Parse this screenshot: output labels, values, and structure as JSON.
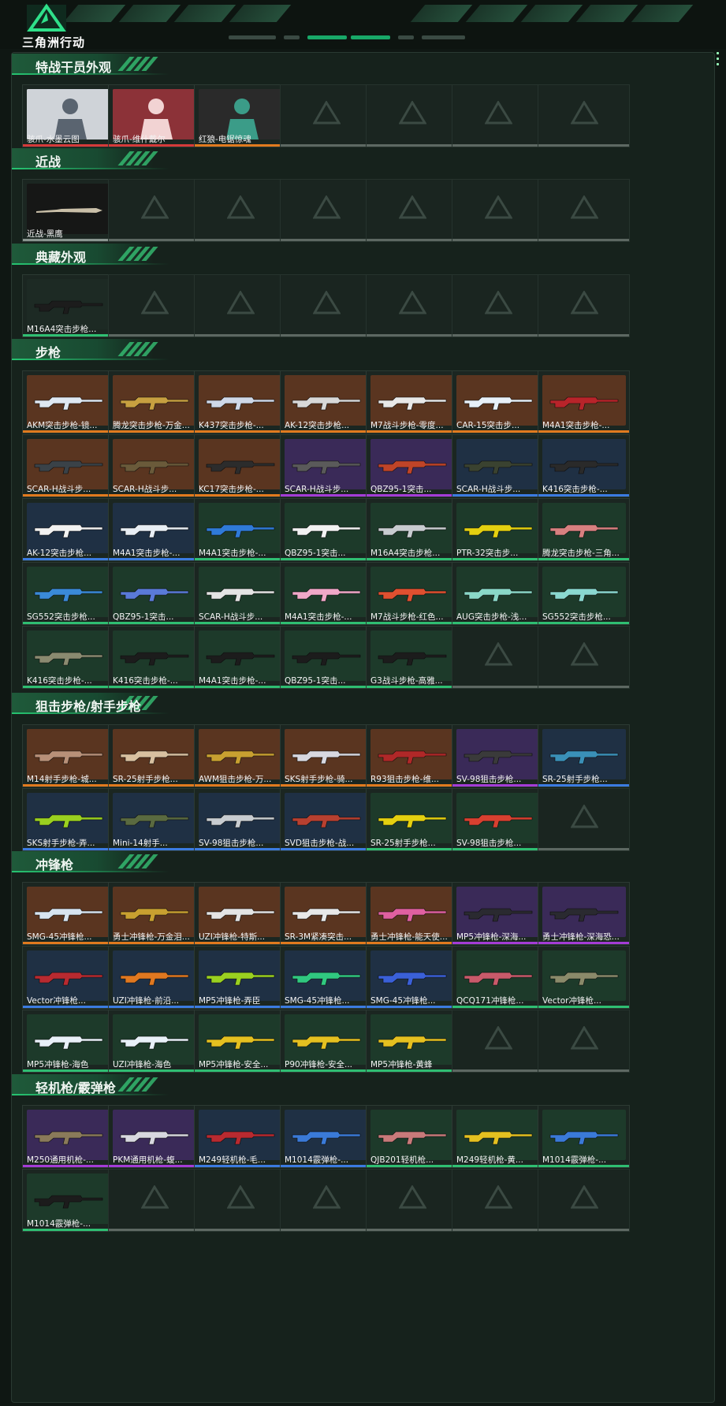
{
  "brand": {
    "title": "三角洲行动"
  },
  "colors": {
    "gold": "#e07a1e",
    "purple": "#a43cd6",
    "blue": "#3b7be0",
    "green": "#2fbe72",
    "red": "#d53a3a",
    "grey": "#8a9690"
  },
  "sections": [
    {
      "title": "特战干员外观",
      "items": [
        {
          "name": "骇爪-水墨云图",
          "rarity": "red",
          "kind": "portrait",
          "bg": "#cfd3d8",
          "fg": "#5a6470"
        },
        {
          "name": "骇爪-维什戴尔",
          "rarity": "red",
          "kind": "portrait",
          "bg": "#8c3238",
          "fg": "#f2d3d3"
        },
        {
          "name": "红狼-电锯惊魂",
          "rarity": "gold",
          "kind": "portrait",
          "bg": "#2a2a2a",
          "fg": "#3b9c88"
        },
        {
          "empty": true
        },
        {
          "empty": true
        },
        {
          "empty": true
        },
        {
          "empty": true
        }
      ]
    },
    {
      "title": "近战",
      "items": [
        {
          "name": "近战-黑鹰",
          "rarity": "grey",
          "kind": "knife",
          "bg": "#161716",
          "fg": "#c9bfa8"
        },
        {
          "empty": true
        },
        {
          "empty": true
        },
        {
          "empty": true
        },
        {
          "empty": true
        },
        {
          "empty": true
        },
        {
          "empty": true
        }
      ]
    },
    {
      "title": "典藏外观",
      "items": [
        {
          "name": "M16A4突击步枪...",
          "rarity": "green",
          "kind": "gun",
          "bg": "#1d2a24",
          "fg": "#1c1c1c"
        },
        {
          "empty": true
        },
        {
          "empty": true
        },
        {
          "empty": true
        },
        {
          "empty": true
        },
        {
          "empty": true
        },
        {
          "empty": true
        }
      ]
    },
    {
      "title": "步枪",
      "items": [
        {
          "name": "AKM突击步枪-镜...",
          "rarity": "gold",
          "kind": "gun",
          "bg": "#5a3520",
          "fg": "#dfe8f2"
        },
        {
          "name": "腾龙突击步枪-万金...",
          "rarity": "gold",
          "kind": "gun",
          "bg": "#5a3520",
          "fg": "#c7a040"
        },
        {
          "name": "K437突击步枪-...",
          "rarity": "gold",
          "kind": "gun",
          "bg": "#5a3520",
          "fg": "#cfd8e8"
        },
        {
          "name": "AK-12突击步枪...",
          "rarity": "gold",
          "kind": "gun",
          "bg": "#5a3520",
          "fg": "#d8d8d8"
        },
        {
          "name": "M7战斗步枪-零度...",
          "rarity": "gold",
          "kind": "gun",
          "bg": "#5a3520",
          "fg": "#e8e8e8"
        },
        {
          "name": "CAR-15突击步...",
          "rarity": "gold",
          "kind": "gun",
          "bg": "#5a3520",
          "fg": "#e8f0f8"
        },
        {
          "name": "M4A1突击步枪-...",
          "rarity": "gold",
          "kind": "gun",
          "bg": "#5a3520",
          "fg": "#b8242a"
        },
        {
          "name": "SCAR-H战斗步...",
          "rarity": "gold",
          "kind": "gun",
          "bg": "#5a3520",
          "fg": "#3a4248"
        },
        {
          "name": "SCAR-H战斗步...",
          "rarity": "gold",
          "kind": "gun",
          "bg": "#5a3520",
          "fg": "#6a5a3a"
        },
        {
          "name": "KC17突击步枪-...",
          "rarity": "gold",
          "kind": "gun",
          "bg": "#5a3520",
          "fg": "#2c2c2c"
        },
        {
          "name": "SCAR-H战斗步...",
          "rarity": "purple",
          "kind": "gun",
          "bg": "#3a2a58",
          "fg": "#5a5a5a"
        },
        {
          "name": "QBZ95-1突击...",
          "rarity": "purple",
          "kind": "gun",
          "bg": "#3a2a58",
          "fg": "#c04428"
        },
        {
          "name": "SCAR-H战斗步...",
          "rarity": "blue",
          "kind": "gun",
          "bg": "#1f3044",
          "fg": "#3a4230"
        },
        {
          "name": "K416突击步枪-...",
          "rarity": "blue",
          "kind": "gun",
          "bg": "#1f3044",
          "fg": "#2a2a2a"
        },
        {
          "name": "AK-12突击步枪...",
          "rarity": "blue",
          "kind": "gun",
          "bg": "#1f3044",
          "fg": "#f2f2f2"
        },
        {
          "name": "M4A1突击步枪-...",
          "rarity": "blue",
          "kind": "gun",
          "bg": "#1f3044",
          "fg": "#e8eef4"
        },
        {
          "name": "M4A1突击步枪-...",
          "rarity": "green",
          "kind": "gun",
          "bg": "#1d3a2a",
          "fg": "#2f7ad8"
        },
        {
          "name": "QBZ95-1突击...",
          "rarity": "green",
          "kind": "gun",
          "bg": "#1d3a2a",
          "fg": "#f2f2f2"
        },
        {
          "name": "M16A4突击步枪...",
          "rarity": "green",
          "kind": "gun",
          "bg": "#1d3a2a",
          "fg": "#c8ccd0"
        },
        {
          "name": "PTR-32突击步...",
          "rarity": "green",
          "kind": "gun",
          "bg": "#1d3a2a",
          "fg": "#e4d010"
        },
        {
          "name": "腾龙突击步枪-三角...",
          "rarity": "green",
          "kind": "gun",
          "bg": "#1d3a2a",
          "fg": "#d88080"
        },
        {
          "name": "SG552突击步枪...",
          "rarity": "green",
          "kind": "gun",
          "bg": "#1d3a2a",
          "fg": "#3a8ad8"
        },
        {
          "name": "QBZ95-1突击...",
          "rarity": "green",
          "kind": "gun",
          "bg": "#1d3a2a",
          "fg": "#5a7ad8"
        },
        {
          "name": "SCAR-H战斗步...",
          "rarity": "green",
          "kind": "gun",
          "bg": "#1d3a2a",
          "fg": "#e4e4e4"
        },
        {
          "name": "M4A1突击步枪-...",
          "rarity": "green",
          "kind": "gun",
          "bg": "#1d3a2a",
          "fg": "#f0a8c8"
        },
        {
          "name": "M7战斗步枪-红色...",
          "rarity": "green",
          "kind": "gun",
          "bg": "#1d3a2a",
          "fg": "#e05030"
        },
        {
          "name": "AUG突击步枪-浅...",
          "rarity": "green",
          "kind": "gun",
          "bg": "#1d3a2a",
          "fg": "#8ad8c8"
        },
        {
          "name": "SG552突击步枪...",
          "rarity": "green",
          "kind": "gun",
          "bg": "#1d3a2a",
          "fg": "#8ad8d0"
        },
        {
          "name": "K416突击步枪-...",
          "rarity": "green",
          "kind": "gun",
          "bg": "#1d3a2a",
          "fg": "#8a8a70"
        },
        {
          "name": "K416突击步枪-...",
          "rarity": "green",
          "kind": "gun",
          "bg": "#1d3a2a",
          "fg": "#1c1c1c"
        },
        {
          "name": "M4A1突击步枪-...",
          "rarity": "green",
          "kind": "gun",
          "bg": "#1d3a2a",
          "fg": "#1c1c1c"
        },
        {
          "name": "QBZ95-1突击...",
          "rarity": "green",
          "kind": "gun",
          "bg": "#1d3a2a",
          "fg": "#1c1c1c"
        },
        {
          "name": "G3战斗步枪-高雅...",
          "rarity": "green",
          "kind": "gun",
          "bg": "#1d3a2a",
          "fg": "#1c1c1c"
        },
        {
          "empty": true
        },
        {
          "empty": true
        }
      ]
    },
    {
      "title": "狙击步枪/射手步枪",
      "items": [
        {
          "name": "M14射手步枪-城...",
          "rarity": "gold",
          "kind": "gun",
          "bg": "#5a3520",
          "fg": "#b89078"
        },
        {
          "name": "SR-25射手步枪...",
          "rarity": "gold",
          "kind": "gun",
          "bg": "#5a3520",
          "fg": "#d8c0a0"
        },
        {
          "name": "AWM狙击步枪-万...",
          "rarity": "gold",
          "kind": "gun",
          "bg": "#5a3520",
          "fg": "#c8a030"
        },
        {
          "name": "SKS射手步枪-骑...",
          "rarity": "gold",
          "kind": "gun",
          "bg": "#5a3520",
          "fg": "#d8d8e0"
        },
        {
          "name": "R93狙击步枪-维...",
          "rarity": "gold",
          "kind": "gun",
          "bg": "#5a3520",
          "fg": "#b02828"
        },
        {
          "name": "SV-98狙击步枪...",
          "rarity": "purple",
          "kind": "gun",
          "bg": "#3a2a58",
          "fg": "#3a3a3a"
        },
        {
          "name": "SR-25射手步枪...",
          "rarity": "blue",
          "kind": "gun",
          "bg": "#1f3044",
          "fg": "#3a90b8"
        },
        {
          "name": "SKS射手步枪-弄...",
          "rarity": "blue",
          "kind": "gun",
          "bg": "#1f3044",
          "fg": "#9ad020"
        },
        {
          "name": "Mini-14射手...",
          "rarity": "blue",
          "kind": "gun",
          "bg": "#1f3044",
          "fg": "#5a6a40"
        },
        {
          "name": "SV-98狙击步枪...",
          "rarity": "blue",
          "kind": "gun",
          "bg": "#1f3044",
          "fg": "#c8ccd0"
        },
        {
          "name": "SVD狙击步枪-战...",
          "rarity": "blue",
          "kind": "gun",
          "bg": "#1f3044",
          "fg": "#b84030"
        },
        {
          "name": "SR-25射手步枪...",
          "rarity": "green",
          "kind": "gun",
          "bg": "#1d3a2a",
          "fg": "#e4d010"
        },
        {
          "name": "SV-98狙击步枪...",
          "rarity": "green",
          "kind": "gun",
          "bg": "#1d3a2a",
          "fg": "#d84030"
        },
        {
          "empty": true
        }
      ]
    },
    {
      "title": "冲锋枪",
      "items": [
        {
          "name": "SMG-45冲锋枪...",
          "rarity": "gold",
          "kind": "gun",
          "bg": "#5a3520",
          "fg": "#d8e4f0"
        },
        {
          "name": "勇士冲锋枪-万金泪...",
          "rarity": "gold",
          "kind": "gun",
          "bg": "#5a3520",
          "fg": "#c8a030"
        },
        {
          "name": "UZI冲锋枪-特斯...",
          "rarity": "gold",
          "kind": "gun",
          "bg": "#5a3520",
          "fg": "#e4e4e4"
        },
        {
          "name": "SR-3M紧凑突击...",
          "rarity": "gold",
          "kind": "gun",
          "bg": "#5a3520",
          "fg": "#e8e8e8"
        },
        {
          "name": "勇士冲锋枪-能天使...",
          "rarity": "gold",
          "kind": "gun",
          "bg": "#5a3520",
          "fg": "#e060a0"
        },
        {
          "name": "MP5冲锋枪-深海...",
          "rarity": "purple",
          "kind": "gun",
          "bg": "#3a2a58",
          "fg": "#2a2a30"
        },
        {
          "name": "勇士冲锋枪-深海恐...",
          "rarity": "purple",
          "kind": "gun",
          "bg": "#3a2a58",
          "fg": "#2a2a30"
        },
        {
          "name": "Vector冲锋枪...",
          "rarity": "blue",
          "kind": "gun",
          "bg": "#1f3044",
          "fg": "#b82a30"
        },
        {
          "name": "UZI冲锋枪-前沿...",
          "rarity": "blue",
          "kind": "gun",
          "bg": "#1f3044",
          "fg": "#e07820"
        },
        {
          "name": "MP5冲锋枪-弄臣",
          "rarity": "blue",
          "kind": "gun",
          "bg": "#1f3044",
          "fg": "#9ad020"
        },
        {
          "name": "SMG-45冲锋枪...",
          "rarity": "blue",
          "kind": "gun",
          "bg": "#1f3044",
          "fg": "#30c880"
        },
        {
          "name": "SMG-45冲锋枪...",
          "rarity": "blue",
          "kind": "gun",
          "bg": "#1f3044",
          "fg": "#3a60d8"
        },
        {
          "name": "QCQ171冲锋枪...",
          "rarity": "green",
          "kind": "gun",
          "bg": "#1d3a2a",
          "fg": "#c85a6a"
        },
        {
          "name": "Vector冲锋枪...",
          "rarity": "green",
          "kind": "gun",
          "bg": "#1d3a2a",
          "fg": "#8a8a6a"
        },
        {
          "name": "MP5冲锋枪-海色",
          "rarity": "green",
          "kind": "gun",
          "bg": "#1d3a2a",
          "fg": "#e8f0f8"
        },
        {
          "name": "UZI冲锋枪-海色",
          "rarity": "green",
          "kind": "gun",
          "bg": "#1d3a2a",
          "fg": "#e8f0f8"
        },
        {
          "name": "MP5冲锋枪-安全...",
          "rarity": "green",
          "kind": "gun",
          "bg": "#1d3a2a",
          "fg": "#e4c020"
        },
        {
          "name": "P90冲锋枪-安全...",
          "rarity": "green",
          "kind": "gun",
          "bg": "#1d3a2a",
          "fg": "#e4c020"
        },
        {
          "name": "MP5冲锋枪-黄蜂",
          "rarity": "green",
          "kind": "gun",
          "bg": "#1d3a2a",
          "fg": "#e4c020"
        },
        {
          "empty": true
        },
        {
          "empty": true
        }
      ]
    },
    {
      "title": "轻机枪/霰弹枪",
      "items": [
        {
          "name": "M250通用机枪-...",
          "rarity": "purple",
          "kind": "gun",
          "bg": "#3a2a58",
          "fg": "#8a7a5a"
        },
        {
          "name": "PKM通用机枪-蝮...",
          "rarity": "purple",
          "kind": "gun",
          "bg": "#3a2a58",
          "fg": "#d8d8e0"
        },
        {
          "name": "M249轻机枪-毛...",
          "rarity": "blue",
          "kind": "gun",
          "bg": "#1f3044",
          "fg": "#b82a30"
        },
        {
          "name": "M1014霰弹枪-...",
          "rarity": "blue",
          "kind": "gun",
          "bg": "#1f3044",
          "fg": "#3a7ad8"
        },
        {
          "name": "QJB201轻机枪...",
          "rarity": "green",
          "kind": "gun",
          "bg": "#1d3a2a",
          "fg": "#c87a7a"
        },
        {
          "name": "M249轻机枪-黄...",
          "rarity": "green",
          "kind": "gun",
          "bg": "#1d3a2a",
          "fg": "#e4c020"
        },
        {
          "name": "M1014霰弹枪-...",
          "rarity": "green",
          "kind": "gun",
          "bg": "#1d3a2a",
          "fg": "#3a7ad8"
        },
        {
          "name": "M1014霰弹枪-...",
          "rarity": "green",
          "kind": "gun",
          "bg": "#1d3a2a",
          "fg": "#1c1c1c"
        },
        {
          "empty": true
        },
        {
          "empty": true
        },
        {
          "empty": true
        },
        {
          "empty": true
        },
        {
          "empty": true
        },
        {
          "empty": true
        }
      ]
    }
  ]
}
